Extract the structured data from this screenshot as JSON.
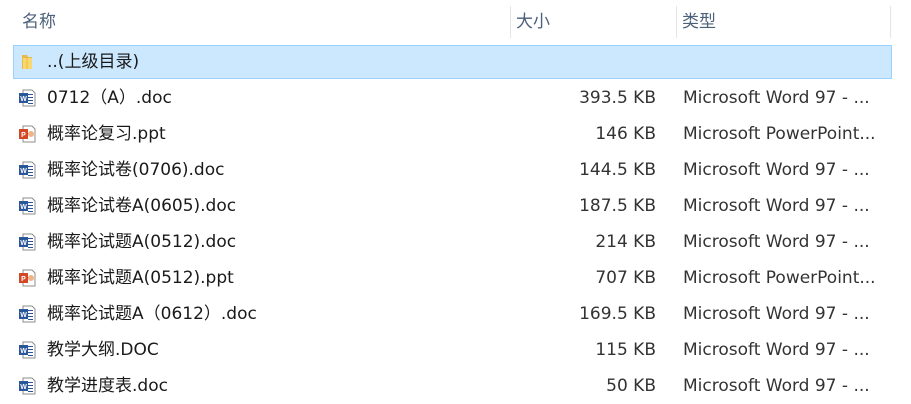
{
  "columns": {
    "name": "名称",
    "size": "大小",
    "type": "类型"
  },
  "files": [
    {
      "name": "..(上级目录)",
      "size": "",
      "type": "",
      "icon": "folder-icon",
      "selected": true
    },
    {
      "name": "0712（A）.doc",
      "size": "393.5 KB",
      "type": "Microsoft Word 97 - ...",
      "icon": "word-doc-icon",
      "selected": false
    },
    {
      "name": "概率论复习.ppt",
      "size": "146 KB",
      "type": "Microsoft PowerPoint...",
      "icon": "powerpoint-icon",
      "selected": false
    },
    {
      "name": "概率论试卷(0706).doc",
      "size": "144.5 KB",
      "type": "Microsoft Word 97 - ...",
      "icon": "word-doc-icon",
      "selected": false
    },
    {
      "name": "概率论试卷A(0605).doc",
      "size": "187.5 KB",
      "type": "Microsoft Word 97 - ...",
      "icon": "word-doc-icon",
      "selected": false
    },
    {
      "name": "概率论试题A(0512).doc",
      "size": "214 KB",
      "type": "Microsoft Word 97 - ...",
      "icon": "word-doc-icon",
      "selected": false
    },
    {
      "name": "概率论试题A(0512).ppt",
      "size": "707 KB",
      "type": "Microsoft PowerPoint...",
      "icon": "powerpoint-icon",
      "selected": false
    },
    {
      "name": "概率论试题A（0612）.doc",
      "size": "169.5 KB",
      "type": "Microsoft Word 97 - ...",
      "icon": "word-doc-icon",
      "selected": false
    },
    {
      "name": "教学大纲.DOC",
      "size": "115 KB",
      "type": "Microsoft Word 97 - ...",
      "icon": "word-doc-icon",
      "selected": false
    },
    {
      "name": "教学进度表.doc",
      "size": "50 KB",
      "type": "Microsoft Word 97 - ...",
      "icon": "word-doc-icon",
      "selected": false
    }
  ],
  "colors": {
    "selection_fill": "#cce8ff",
    "selection_border": "#99d1ff",
    "header_text": "#4c607a",
    "word_blue": "#2b579a",
    "powerpoint_red": "#d24726",
    "folder_yellow": "#f8d775"
  }
}
